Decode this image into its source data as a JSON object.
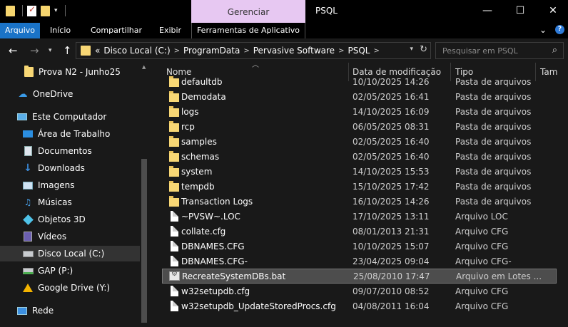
{
  "window": {
    "title": "PSQL",
    "context_tab_header": "Gerenciar",
    "controls": {
      "minimize": "—",
      "maximize": "☐",
      "close": "✕"
    }
  },
  "ribbon": {
    "file_tab": "Arquivo",
    "tabs": [
      "Início",
      "Compartilhar",
      "Exibir"
    ],
    "context_tab": "Ferramentas de Aplicativo"
  },
  "address_bar": {
    "overflow": "«",
    "crumbs": [
      "Disco Local (C:)",
      "ProgramData",
      "Pervasive Software",
      "PSQL"
    ]
  },
  "search": {
    "placeholder": "Pesquisar em PSQL"
  },
  "sidebar": {
    "items": [
      {
        "label": "Prova N2 - Junho25",
        "icon": "folder-icon"
      },
      {
        "label": "OneDrive",
        "icon": "cloud-icon"
      },
      {
        "label": "Este Computador",
        "icon": "computer-icon"
      },
      {
        "label": "Área de Trabalho",
        "icon": "desktop-icon"
      },
      {
        "label": "Documentos",
        "icon": "document-icon"
      },
      {
        "label": "Downloads",
        "icon": "download-icon"
      },
      {
        "label": "Imagens",
        "icon": "image-icon"
      },
      {
        "label": "Músicas",
        "icon": "music-icon"
      },
      {
        "label": "Objetos 3D",
        "icon": "cube-icon"
      },
      {
        "label": "Vídeos",
        "icon": "video-icon"
      },
      {
        "label": "Disco Local (C:)",
        "icon": "drive-icon",
        "selected": true
      },
      {
        "label": "GAP (P:)",
        "icon": "network-drive-icon"
      },
      {
        "label": "Google Drive (Y:)",
        "icon": "google-drive-icon"
      },
      {
        "label": "Rede",
        "icon": "network-icon"
      }
    ]
  },
  "columns": {
    "name": "Nome",
    "date": "Data de modificação",
    "type": "Tipo",
    "size": "Tam"
  },
  "files": [
    {
      "name": "defaultdb",
      "date": "10/10/2025 14:26",
      "type": "Pasta de arquivos",
      "kind": "folder",
      "partial": true
    },
    {
      "name": "Demodata",
      "date": "02/05/2025 16:41",
      "type": "Pasta de arquivos",
      "kind": "folder"
    },
    {
      "name": "logs",
      "date": "14/10/2025 16:09",
      "type": "Pasta de arquivos",
      "kind": "folder"
    },
    {
      "name": "rcp",
      "date": "06/05/2025 08:31",
      "type": "Pasta de arquivos",
      "kind": "folder"
    },
    {
      "name": "samples",
      "date": "02/05/2025 16:40",
      "type": "Pasta de arquivos",
      "kind": "folder"
    },
    {
      "name": "schemas",
      "date": "02/05/2025 16:40",
      "type": "Pasta de arquivos",
      "kind": "folder"
    },
    {
      "name": "system",
      "date": "14/10/2025 15:53",
      "type": "Pasta de arquivos",
      "kind": "folder"
    },
    {
      "name": "tempdb",
      "date": "15/10/2025 17:42",
      "type": "Pasta de arquivos",
      "kind": "folder"
    },
    {
      "name": "Transaction Logs",
      "date": "16/10/2025 14:26",
      "type": "Pasta de arquivos",
      "kind": "folder"
    },
    {
      "name": "~PVSW~.LOC",
      "date": "17/10/2025 13:11",
      "type": "Arquivo LOC",
      "kind": "file"
    },
    {
      "name": "collate.cfg",
      "date": "08/01/2013 21:31",
      "type": "Arquivo CFG",
      "kind": "file"
    },
    {
      "name": "DBNAMES.CFG",
      "date": "10/10/2025 15:07",
      "type": "Arquivo CFG",
      "kind": "file"
    },
    {
      "name": "DBNAMES.CFG-",
      "date": "23/04/2025 09:04",
      "type": "Arquivo CFG-",
      "kind": "file"
    },
    {
      "name": "RecreateSystemDBs.bat",
      "date": "25/08/2010 17:47",
      "type": "Arquivo em Lotes ...",
      "kind": "bat",
      "highlighted": true
    },
    {
      "name": "w32setupdb.cfg",
      "date": "09/07/2010 08:52",
      "type": "Arquivo CFG",
      "kind": "file"
    },
    {
      "name": "w32setupdb_UpdateStoredProcs.cfg",
      "date": "04/08/2011 16:04",
      "type": "Arquivo CFG",
      "kind": "file"
    }
  ]
}
